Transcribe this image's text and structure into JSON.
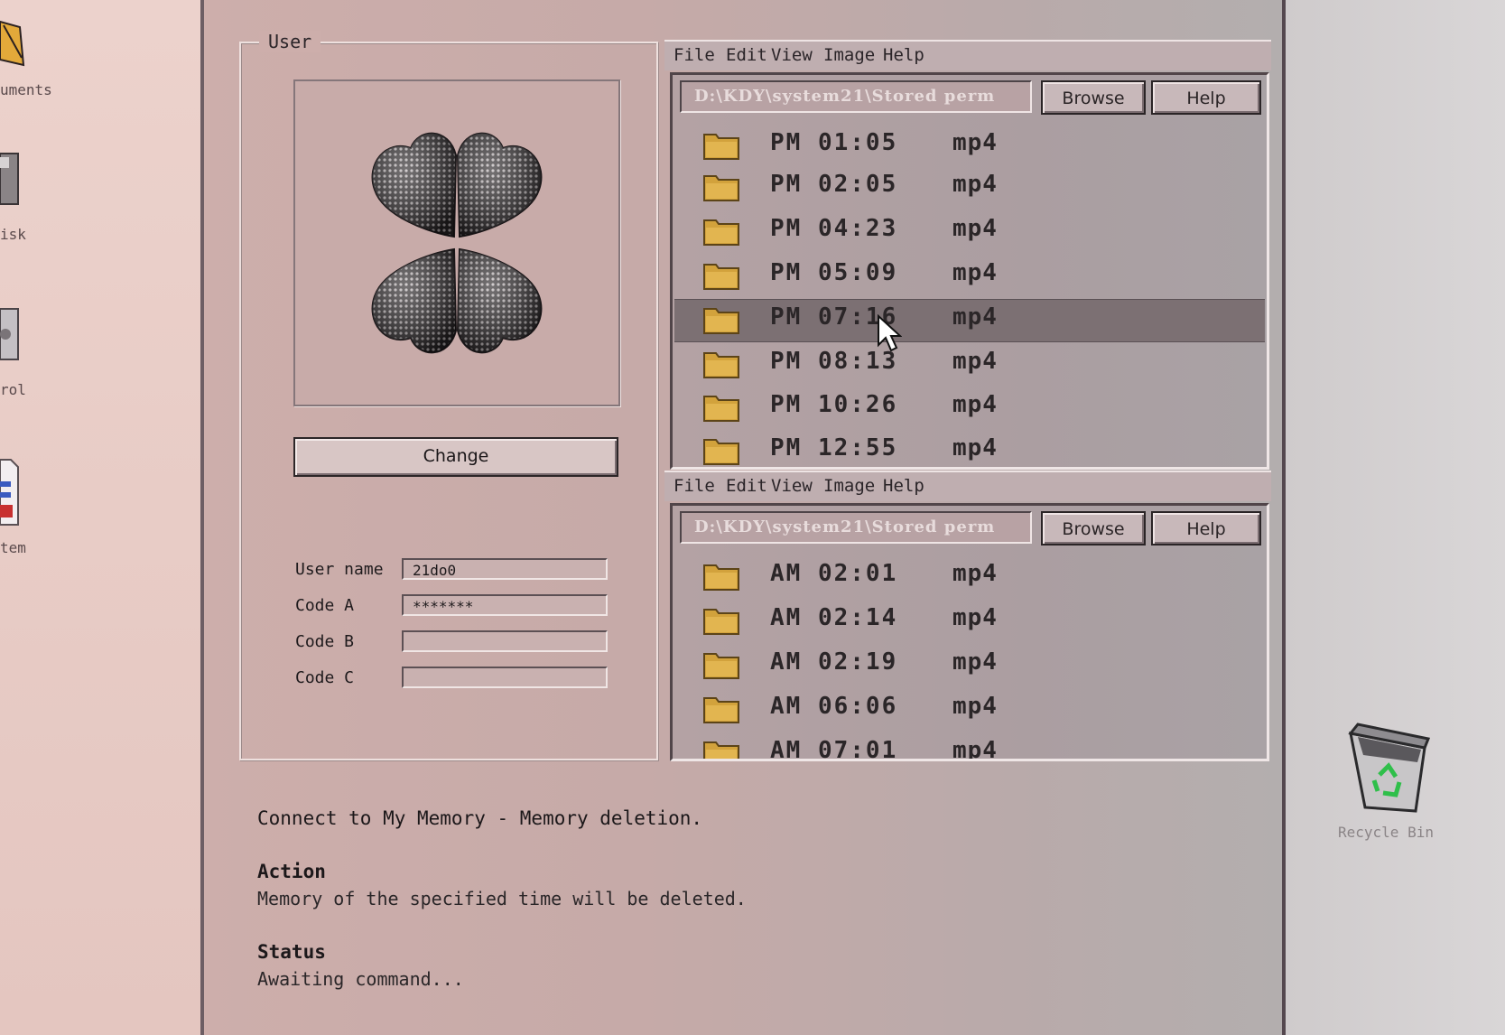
{
  "desktop": {
    "left_icons": [
      {
        "label": "uments",
        "icon": "documents-folder-icon"
      },
      {
        "label": "isk",
        "icon": "disk-icon"
      },
      {
        "label": "rol",
        "icon": "control-panel-icon"
      },
      {
        "label": "tem",
        "icon": "system-document-icon"
      }
    ],
    "recycle_bin": {
      "label": "Recycle Bin",
      "icon": "recycle-bin-icon"
    }
  },
  "user_panel": {
    "title": "User",
    "change_label": "Change",
    "fields": [
      {
        "label": "User name",
        "value": "21do0"
      },
      {
        "label": "Code A",
        "value": "*******"
      },
      {
        "label": "Code B",
        "value": ""
      },
      {
        "label": "Code C",
        "value": ""
      }
    ]
  },
  "file_windows": [
    {
      "menu": [
        "File",
        "Edit",
        "View",
        "Image",
        "Help"
      ],
      "path": "D:\\KDY\\system21\\Stored perm",
      "browse_label": "Browse",
      "help_label": "Help",
      "files": [
        {
          "time": "PM 01:05",
          "ext": "mp4"
        },
        {
          "time": "PM 02:05",
          "ext": "mp4"
        },
        {
          "time": "PM 04:23",
          "ext": "mp4"
        },
        {
          "time": "PM 05:09",
          "ext": "mp4"
        },
        {
          "time": "PM 07:16",
          "ext": "mp4",
          "selected": true
        },
        {
          "time": "PM 08:13",
          "ext": "mp4"
        },
        {
          "time": "PM 10:26",
          "ext": "mp4"
        },
        {
          "time": "PM 12:55",
          "ext": "mp4"
        }
      ]
    },
    {
      "menu": [
        "File",
        "Edit",
        "View",
        "Image",
        "Help"
      ],
      "path": "D:\\KDY\\system21\\Stored perm",
      "browse_label": "Browse",
      "help_label": "Help",
      "files": [
        {
          "time": "AM 02:01",
          "ext": "mp4"
        },
        {
          "time": "AM 02:14",
          "ext": "mp4"
        },
        {
          "time": "AM 02:19",
          "ext": "mp4"
        },
        {
          "time": "AM 06:06",
          "ext": "mp4"
        },
        {
          "time": "AM 07:01",
          "ext": "mp4"
        }
      ]
    }
  ],
  "status_area": {
    "headline": "Connect to My Memory - Memory deletion.",
    "action_title": "Action",
    "action_text": "Memory of the specified time will be deleted.",
    "status_title": "Status",
    "status_text": "Awaiting command..."
  }
}
